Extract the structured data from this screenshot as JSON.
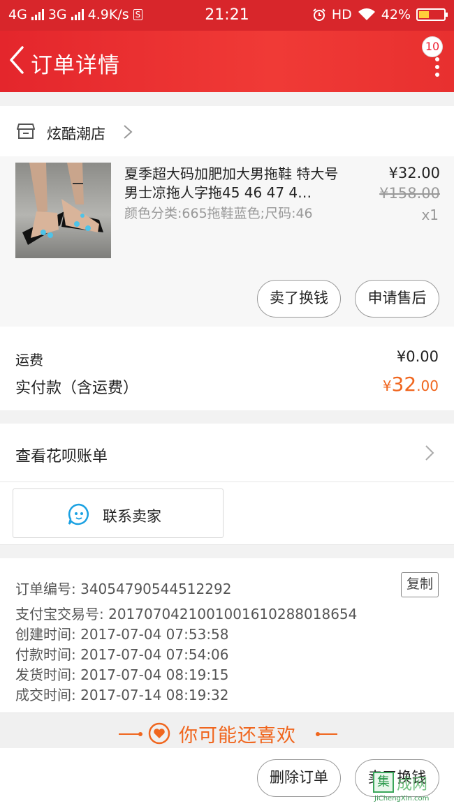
{
  "status_bar": {
    "net1": "4G",
    "net2": "3G",
    "speed": "4.9K/s",
    "s_icon": "S",
    "time": "21:21",
    "hd": "HD",
    "battery": "42%",
    "battery_level": 0.42
  },
  "header": {
    "title": "订单详情",
    "badge": "10"
  },
  "shop": {
    "name": "炫酷潮店"
  },
  "product": {
    "title": "夏季超大码加肥加大男拖鞋 特大号男士凉拖人字拖45 46 47 4…",
    "spec": "颜色分类:665拖鞋蓝色;尺码:46",
    "price": "¥32.00",
    "original_price": "¥158.00",
    "quantity": "x1",
    "buttons": {
      "sell": "卖了换钱",
      "after_sale": "申请售后"
    }
  },
  "fees": {
    "shipping_label": "运费",
    "shipping_value": "¥0.00",
    "paid_label": "实付款（含运费）",
    "paid_currency": "¥",
    "paid_int": "32",
    "paid_dec": ".00"
  },
  "huabei": {
    "label": "查看花呗账单"
  },
  "contact": {
    "label": "联系卖家"
  },
  "order_info": {
    "order_no": "订单编号: 34054790544512292",
    "copy": "复制",
    "alipay_no": "支付宝交易号: 2017070421001001610288018654",
    "created": "创建时间: 2017-07-04 07:53:58",
    "paid": "付款时间: 2017-07-04 07:54:06",
    "shipped": "发货时间: 2017-07-04 08:19:15",
    "completed": "成交时间: 2017-07-14 08:19:32"
  },
  "recommend": {
    "title": "你可能还喜欢"
  },
  "bottom_bar": {
    "delete": "删除订单",
    "sell": "卖了换钱"
  },
  "watermark": {
    "box": "集",
    "big": "成网",
    "small": "JiChengXin.com"
  },
  "colors": {
    "brand_red": "#e4262c",
    "price_orange": "#f0661e"
  }
}
